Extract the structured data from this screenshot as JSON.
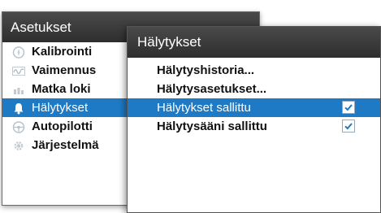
{
  "settings": {
    "title": "Asetukset",
    "items": [
      {
        "label": "Kalibrointi",
        "icon": "compass-icon"
      },
      {
        "label": "Vaimennus",
        "icon": "damping-wave-icon"
      },
      {
        "label": "Matka loki",
        "icon": "trip-log-icon"
      },
      {
        "label": "Hälytykset",
        "icon": "alarm-bell-icon",
        "selected": true
      },
      {
        "label": "Autopilotti",
        "icon": "steering-wheel-icon"
      },
      {
        "label": "Järjestelmä",
        "icon": "system-gear-icon"
      }
    ]
  },
  "alarms": {
    "title": "Hälytykset",
    "items": [
      {
        "label": "Hälytyshistoria..."
      },
      {
        "label": "Hälytysasetukset..."
      },
      {
        "label": "Hälytykset sallittu",
        "checked": true,
        "selected": true
      },
      {
        "label": "Hälytysääni sallittu",
        "checked": true
      }
    ]
  },
  "colors": {
    "selection": "#1f7ac6",
    "header": "#3a3a3a",
    "checkmark": "#1f7ac6"
  }
}
